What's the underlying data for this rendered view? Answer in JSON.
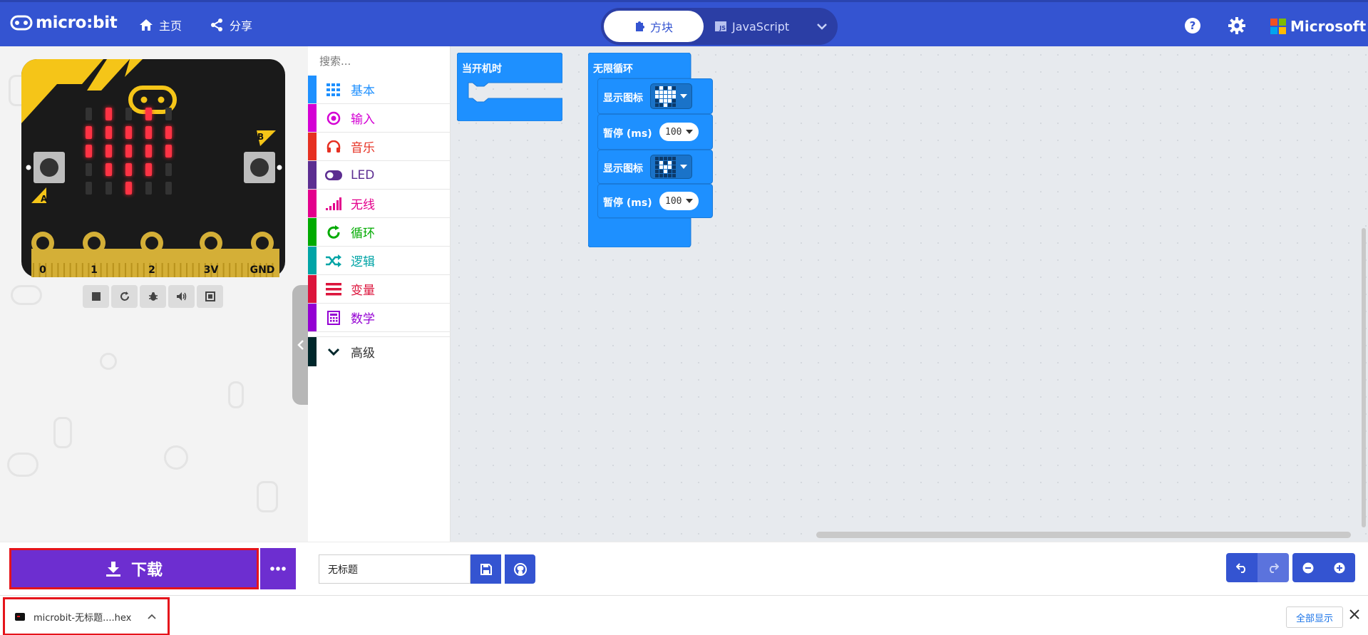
{
  "header": {
    "logo_text": "micro:bit",
    "nav_home": "主页",
    "nav_share": "分享",
    "tab_blocks": "方块",
    "tab_js": "JavaScript",
    "js_badge": "JS",
    "ms_label": "Microsoft"
  },
  "simulator": {
    "pins": [
      "0",
      "1",
      "2",
      "3V",
      "GND"
    ],
    "button_a": "A",
    "button_b": "B",
    "led_matrix": [
      [
        0,
        1,
        0,
        1,
        0
      ],
      [
        1,
        1,
        1,
        1,
        1
      ],
      [
        1,
        1,
        1,
        1,
        1
      ],
      [
        0,
        1,
        1,
        1,
        0
      ],
      [
        0,
        0,
        1,
        0,
        0
      ]
    ],
    "controls": [
      "stop-icon",
      "restart-icon",
      "debug-icon",
      "sound-icon",
      "fullscreen-icon"
    ]
  },
  "toolbox": {
    "search_placeholder": "搜索...",
    "categories": [
      {
        "label": "基本",
        "color": "#1e90ff",
        "icon": "grid-icon"
      },
      {
        "label": "输入",
        "color": "#d400d4",
        "icon": "target-icon"
      },
      {
        "label": "音乐",
        "color": "#e63022",
        "icon": "headphones-icon"
      },
      {
        "label": "LED",
        "color": "#5c2d91",
        "icon": "toggle-icon"
      },
      {
        "label": "无线",
        "color": "#e3008c",
        "icon": "signal-icon"
      },
      {
        "label": "循环",
        "color": "#00aa00",
        "icon": "refresh-icon"
      },
      {
        "label": "逻辑",
        "color": "#00a4a6",
        "icon": "shuffle-icon"
      },
      {
        "label": "变量",
        "color": "#dc143c",
        "icon": "list-icon"
      },
      {
        "label": "数学",
        "color": "#9400d3",
        "icon": "calculator-icon"
      }
    ],
    "advanced": {
      "label": "高级",
      "color": "#00272b"
    }
  },
  "workspace": {
    "on_start_label": "当开机时",
    "forever_label": "无限循环",
    "show_icon_label": "显示图标",
    "pause_label": "暂停 (ms)",
    "pause_value": "100",
    "icon_heart": [
      [
        0,
        1,
        0,
        1,
        0
      ],
      [
        1,
        1,
        1,
        1,
        1
      ],
      [
        1,
        1,
        1,
        1,
        1
      ],
      [
        0,
        1,
        1,
        1,
        0
      ],
      [
        0,
        0,
        1,
        0,
        0
      ]
    ],
    "icon_small_heart": [
      [
        0,
        0,
        0,
        0,
        0
      ],
      [
        0,
        1,
        0,
        1,
        0
      ],
      [
        0,
        1,
        1,
        1,
        0
      ],
      [
        0,
        0,
        1,
        0,
        0
      ],
      [
        0,
        0,
        0,
        0,
        0
      ]
    ]
  },
  "bottom": {
    "download_label": "下载",
    "project_name": "无标题"
  },
  "shelf": {
    "file_name": "microbit-无标题....hex",
    "show_all": "全部显示"
  },
  "colors": {
    "menubar": "#3454d1",
    "download": "#6d2ed0",
    "block_blue": "#1e90ff",
    "highlight_red": "#e5141b"
  }
}
